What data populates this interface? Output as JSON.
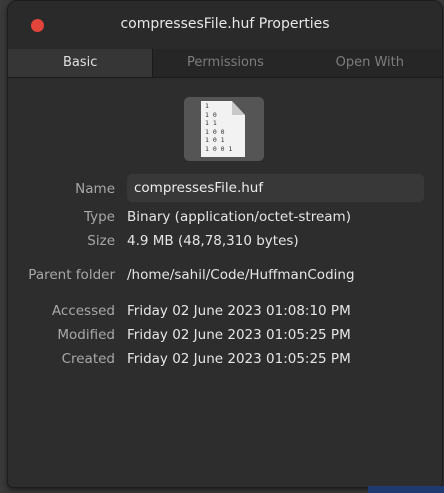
{
  "window": {
    "title": "compressesFile.huf Properties",
    "close_color": "#e3453a"
  },
  "tabs": [
    {
      "label": "Basic",
      "active": true
    },
    {
      "label": "Permissions",
      "active": false
    },
    {
      "label": "Open With",
      "active": false
    }
  ],
  "file_icon": {
    "name": "binary-file-icon",
    "lines": "1\n1 0\n1 1\n1 0 0\n1 0 1\n1 0 0 1"
  },
  "fields": {
    "name": {
      "label": "Name",
      "value": "compressesFile.huf"
    },
    "type": {
      "label": "Type",
      "value": "Binary (application/octet-stream)"
    },
    "size": {
      "label": "Size",
      "value": "4.9 MB (48,78,310 bytes)"
    },
    "parent": {
      "label": "Parent folder",
      "value": "/home/sahil/Code/HuffmanCoding"
    },
    "accessed": {
      "label": "Accessed",
      "value": "Friday 02 June 2023 01:08:10 PM"
    },
    "modified": {
      "label": "Modified",
      "value": "Friday 02 June 2023 01:05:25 PM"
    },
    "created": {
      "label": "Created",
      "value": "Friday 02 June 2023 01:05:25 PM"
    }
  }
}
